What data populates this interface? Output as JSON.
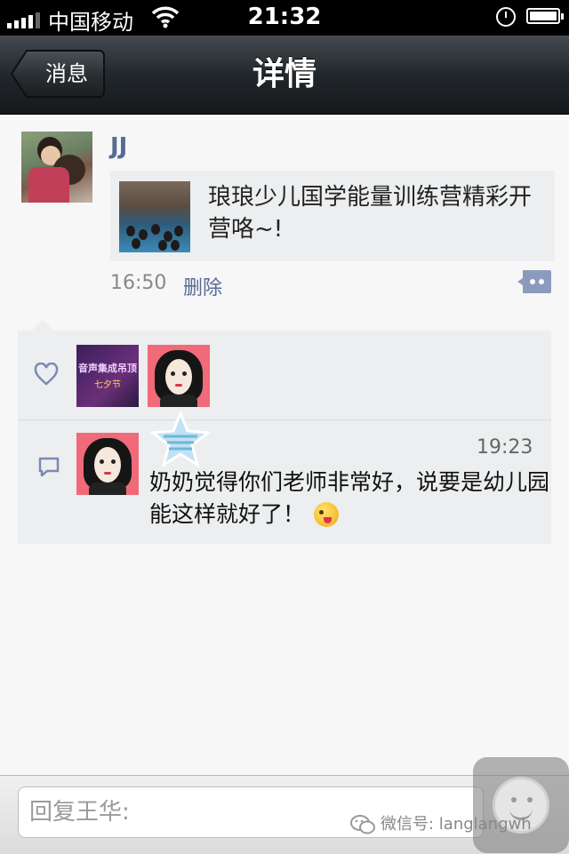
{
  "status_bar": {
    "carrier": "中国移动",
    "time": "21:32",
    "battery_level": 1.0,
    "icons": [
      "signal-icon",
      "wifi-icon",
      "alarm-icon",
      "battery-icon"
    ]
  },
  "nav": {
    "back_label": "消息",
    "title": "详情"
  },
  "post": {
    "author": "JJ",
    "link_text": "琅琅少儿国学能量训练营精彩开营咯~!",
    "time": "16:50",
    "delete_label": "删除"
  },
  "likes": {
    "avatars": [
      {
        "line1": "音声集成吊顶",
        "line2": "七夕节"
      },
      {
        "type": "cartoon-girl"
      }
    ]
  },
  "comment": {
    "time": "19:23",
    "text": "奶奶觉得你们老师非常好，说要是幼儿园能这样就好了！"
  },
  "reply": {
    "placeholder": "回复王华:"
  },
  "watermark": {
    "text": "微信号: langlangwh"
  },
  "colors": {
    "name_blue": "#576b95",
    "panel_bg": "#eceeef",
    "nav_dark": "#22272b"
  }
}
